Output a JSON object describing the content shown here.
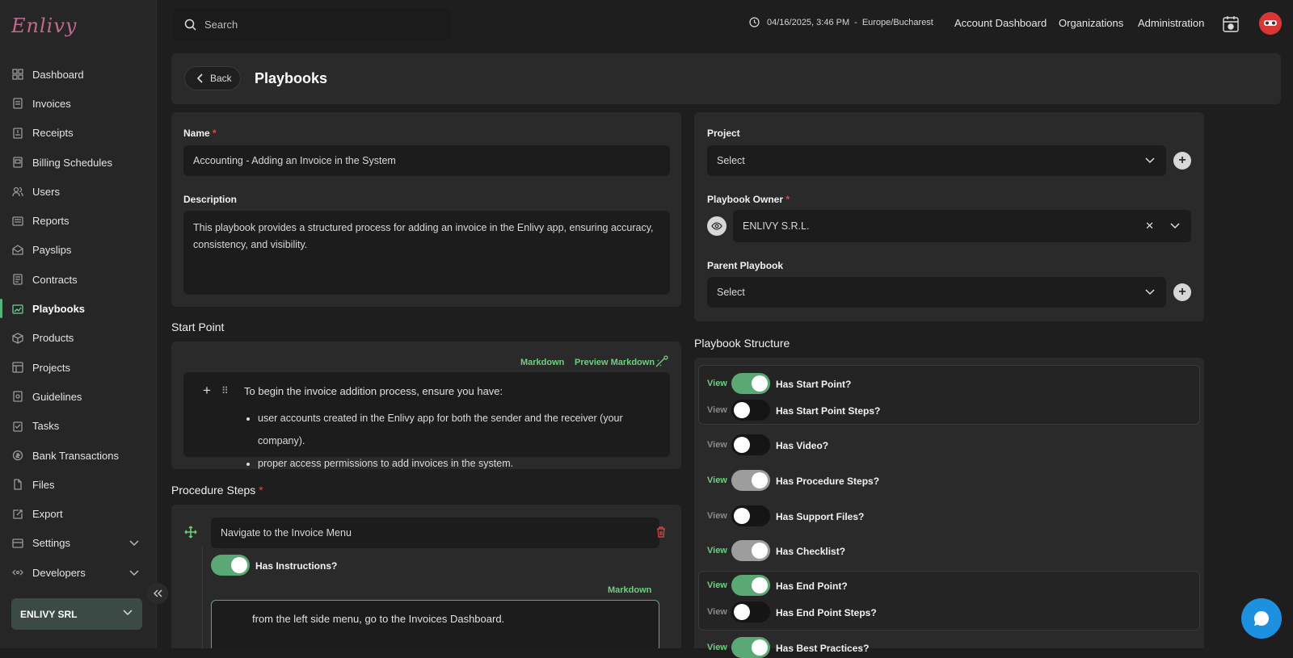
{
  "app": {
    "logo": "Enlivy"
  },
  "sidebar": {
    "items": [
      {
        "label": "Dashboard",
        "icon": "grid-icon"
      },
      {
        "label": "Invoices",
        "icon": "invoice-icon"
      },
      {
        "label": "Receipts",
        "icon": "receipt-icon"
      },
      {
        "label": "Billing Schedules",
        "icon": "schedule-icon"
      },
      {
        "label": "Users",
        "icon": "users-icon"
      },
      {
        "label": "Reports",
        "icon": "reports-icon"
      },
      {
        "label": "Payslips",
        "icon": "payslip-icon"
      },
      {
        "label": "Contracts",
        "icon": "contract-icon"
      },
      {
        "label": "Playbooks",
        "icon": "playbook-icon"
      },
      {
        "label": "Products",
        "icon": "box-icon"
      },
      {
        "label": "Projects",
        "icon": "projects-icon"
      },
      {
        "label": "Guidelines",
        "icon": "guidelines-icon"
      },
      {
        "label": "Tasks",
        "icon": "tasks-icon"
      },
      {
        "label": "Bank Transactions",
        "icon": "bank-icon"
      },
      {
        "label": "Files",
        "icon": "file-icon"
      },
      {
        "label": "Export",
        "icon": "export-icon"
      },
      {
        "label": "Settings",
        "icon": "settings-icon"
      },
      {
        "label": "Developers",
        "icon": "developers-icon"
      }
    ],
    "active": "Playbooks",
    "org": "ENLIVY SRL"
  },
  "topbar": {
    "search_placeholder": "Search",
    "datetime": "04/16/2025, 3:46 PM",
    "separator": "-",
    "timezone": "Europe/Bucharest",
    "links": [
      "Account Dashboard",
      "Organizations",
      "Administration"
    ]
  },
  "header": {
    "back_label": "Back",
    "title": "Playbooks"
  },
  "form": {
    "name_label": "Name",
    "required_mark": "*",
    "name_value": "Accounting - Adding an Invoice in the System",
    "description_label": "Description",
    "description_value": "This playbook provides a structured process for adding an invoice in the Enlivy app, ensuring accuracy, consistency, and visibility.",
    "project_label": "Project",
    "project_value": "Select",
    "owner_label": "Playbook Owner",
    "owner_value": "ENLIVY S.R.L.",
    "parent_label": "Parent Playbook",
    "parent_value": "Select"
  },
  "start_point": {
    "title": "Start Point",
    "markdown_label": "Markdown",
    "preview_label": "Preview Markdown",
    "intro": "To begin the invoice addition process, ensure you have:",
    "bullets": [
      "user accounts created in the Enlivy app for both the sender and the receiver (your company).",
      "proper access permissions to add invoices in the system."
    ]
  },
  "procedure": {
    "title": "Procedure Steps",
    "step_title": "Navigate to the Invoice Menu",
    "has_instructions_label": "Has Instructions?",
    "markdown_label": "Markdown",
    "instruction_text": "from the left side menu, go to the Invoices Dashboard."
  },
  "structure": {
    "title": "Playbook Structure",
    "view_label": "View",
    "toggles": [
      {
        "label": "Has Start Point?",
        "state": "on"
      },
      {
        "label": "Has Start Point Steps?",
        "state": "off"
      },
      {
        "label": "Has Video?",
        "state": "off"
      },
      {
        "label": "Has Procedure Steps?",
        "state": "gray"
      },
      {
        "label": "Has Support Files?",
        "state": "off"
      },
      {
        "label": "Has Checklist?",
        "state": "gray"
      },
      {
        "label": "Has End Point?",
        "state": "on"
      },
      {
        "label": "Has End Point Steps?",
        "state": "off"
      },
      {
        "label": "Has Best Practices?",
        "state": "on"
      }
    ]
  },
  "colors": {
    "accent": "#6fcf7f",
    "toggle_on": "#5aa874",
    "chat": "#1e90e0",
    "required": "#d94c4c"
  }
}
